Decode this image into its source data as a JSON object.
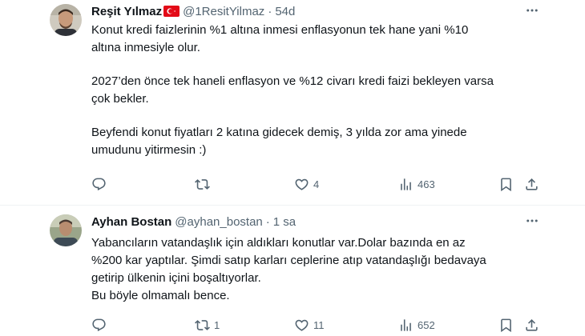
{
  "tweets": [
    {
      "name": "Reşit Yılmaz",
      "handle": "@1ResitYilmaz",
      "separator": "·",
      "time": "54d",
      "lines": [
        "Konut kredi faizlerinin %1 altına inmesi enflasyonun tek hane yani %10",
        "altına inmesiyle olur.",
        "",
        "2027’den önce tek haneli enflasyon ve %12 civarı kredi faizi bekleyen varsa",
        "çok bekler.",
        "",
        "Beyfendi konut fiyatları 2 katına gidecek demiş, 3 yılda zor ama yinede",
        "umudunu yitirmesin :)"
      ],
      "actions": {
        "replies": "",
        "retweets": "",
        "likes": "4",
        "views": "463"
      }
    },
    {
      "name": "Ayhan Bostan",
      "handle": "@ayhan_bostan",
      "separator": "·",
      "time": "1 sa",
      "lines": [
        "Yabancıların vatandaşlık için aldıkları konutlar var.Dolar bazında en az",
        "%200 kar yaptılar. Şimdi satıp karları ceplerine atıp vatandaşlığı bedavaya",
        "getirip ülkenin içini boşaltıyorlar.",
        "Bu böyle olmamalı bence."
      ],
      "actions": {
        "replies": "",
        "retweets": "1",
        "likes": "11",
        "views": "652"
      }
    }
  ],
  "icons": {
    "more": "more-horizontal-icon",
    "reply": "reply-icon",
    "retweet": "retweet-icon",
    "like": "heart-icon",
    "views": "analytics-icon",
    "bookmark": "bookmark-icon",
    "share": "share-icon",
    "flag": "turkey-flag-icon"
  },
  "colors": {
    "text": "#0f1419",
    "secondary": "#536471",
    "divider": "#eff3f4",
    "flag_red": "#e30a17"
  }
}
